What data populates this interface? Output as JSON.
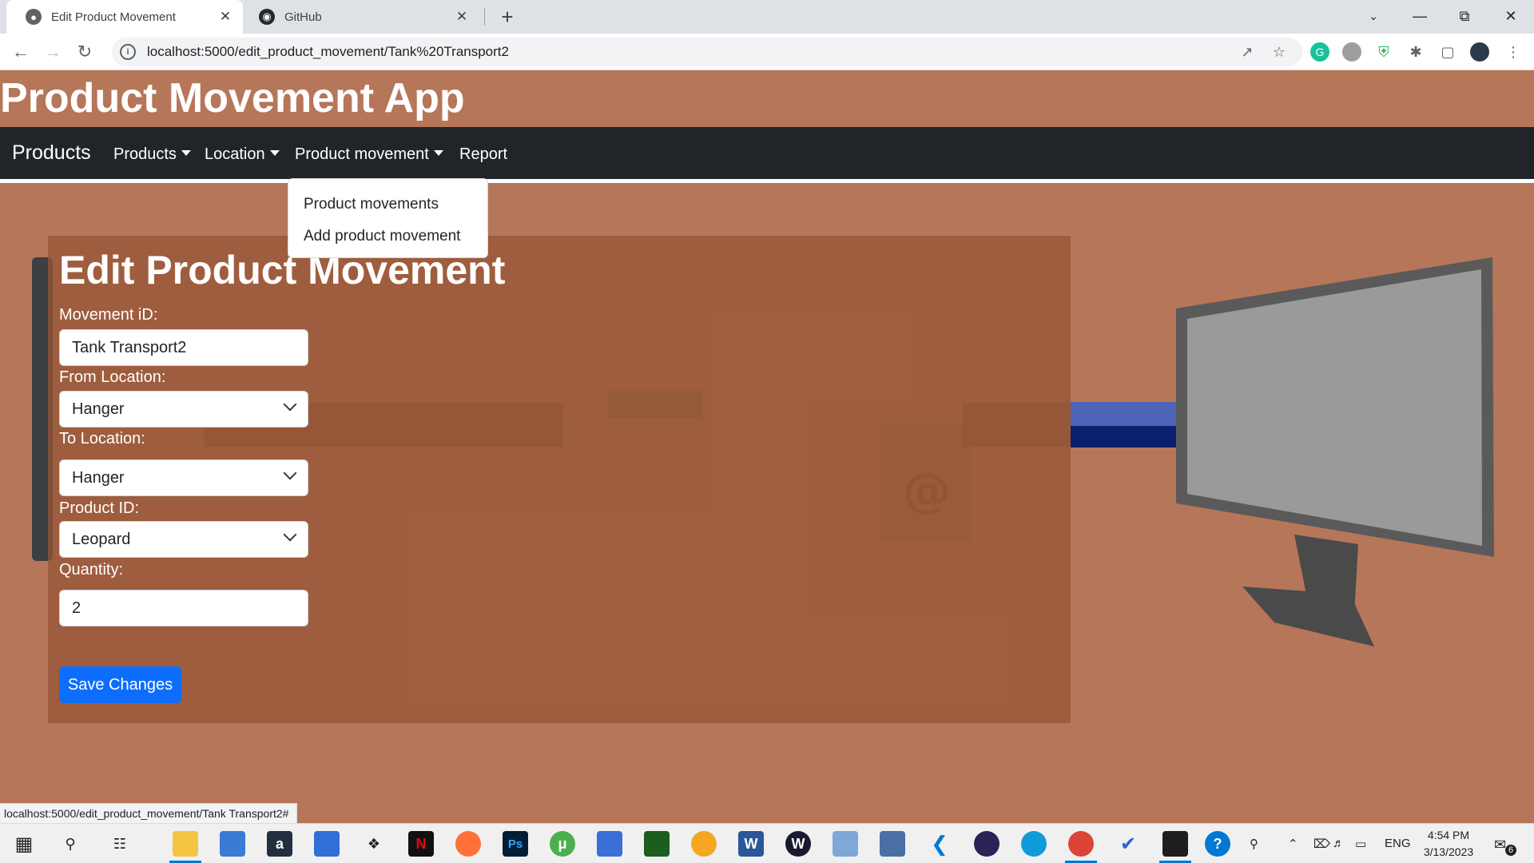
{
  "browser": {
    "tabs": [
      {
        "title": "Edit Product Movement",
        "active": true,
        "icon": "globe-icon"
      },
      {
        "title": "GitHub",
        "active": false,
        "icon": "github-icon"
      }
    ],
    "url": "localhost:5000/edit_product_movement/Tank%20Transport2",
    "status_url": "localhost:5000/edit_product_movement/Tank Transport2#"
  },
  "app": {
    "title": "Product Movement App"
  },
  "navbar": {
    "brand": "Products",
    "items": [
      {
        "label": "Products",
        "dropdown": true
      },
      {
        "label": "Location",
        "dropdown": true
      },
      {
        "label": "Product movement",
        "dropdown": true
      },
      {
        "label": "Report",
        "dropdown": false
      }
    ],
    "open_menu": {
      "items": [
        "Product movements",
        "Add product movement"
      ]
    }
  },
  "form": {
    "heading": "Edit Product Movement",
    "movement_id_label": "Movement iD:",
    "movement_id_value": "Tank Transport2",
    "from_location_label": "From Location:",
    "from_location_value": "Hanger",
    "to_location_label": "To Location:",
    "to_location_value": "Hanger",
    "product_id_label": "Product ID:",
    "product_id_value": "Leopard",
    "quantity_label": "Quantity:",
    "quantity_value": "2",
    "save_label": "Save Changes"
  },
  "taskbar": {
    "language": "ENG",
    "time": "4:54 PM",
    "date": "3/13/2023",
    "notification_count": "6"
  },
  "colors": {
    "page_bg": "#b67659",
    "navbar_bg": "#212529",
    "primary_button": "#0d6efd"
  }
}
